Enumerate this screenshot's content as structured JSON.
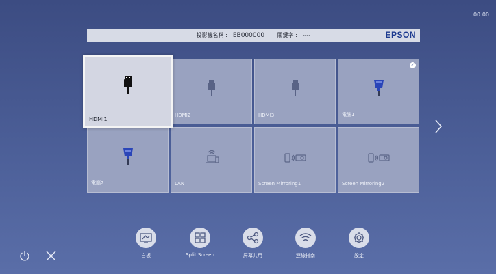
{
  "clock": "00:00",
  "info_bar": {
    "name_label": "投影機名稱 :",
    "name_value": "EB000000",
    "keyword_label": "關鍵字 :",
    "keyword_value": "----",
    "brand": "EPSON"
  },
  "sources": [
    {
      "label": "HDMI1",
      "icon": "hdmi-icon",
      "selected": true,
      "checked": false
    },
    {
      "label": "HDMI2",
      "icon": "hdmi-icon",
      "selected": false,
      "checked": false
    },
    {
      "label": "HDMI3",
      "icon": "hdmi-icon",
      "selected": false,
      "checked": false
    },
    {
      "label": "電腦1",
      "icon": "vga-icon",
      "selected": false,
      "checked": true
    },
    {
      "label": "電腦2",
      "icon": "vga-icon",
      "selected": false,
      "checked": false
    },
    {
      "label": "LAN",
      "icon": "lan-computer-icon",
      "selected": false,
      "checked": false
    },
    {
      "label": "Screen Mirroring1",
      "icon": "screen-mirroring-icon",
      "selected": false,
      "checked": false
    },
    {
      "label": "Screen Mirroring2",
      "icon": "screen-mirroring-icon",
      "selected": false,
      "checked": false
    }
  ],
  "navigation": {
    "next_icon": "chevron-right-icon"
  },
  "toolbar": [
    {
      "label": "白板",
      "icon": "whiteboard-icon"
    },
    {
      "label": "Split Screen",
      "icon": "split-screen-icon"
    },
    {
      "label": "屏幕共用",
      "icon": "share-icon"
    },
    {
      "label": "連線指南",
      "icon": "wifi-icon"
    },
    {
      "label": "設定",
      "icon": "gear-icon"
    }
  ],
  "system": {
    "power_icon": "power-icon",
    "close_icon": "close-icon"
  },
  "colors": {
    "background": "#4c5f98",
    "tile": "#99a2c0",
    "selected_tile": "#d3d6e2",
    "brand": "#1d3a8f"
  }
}
